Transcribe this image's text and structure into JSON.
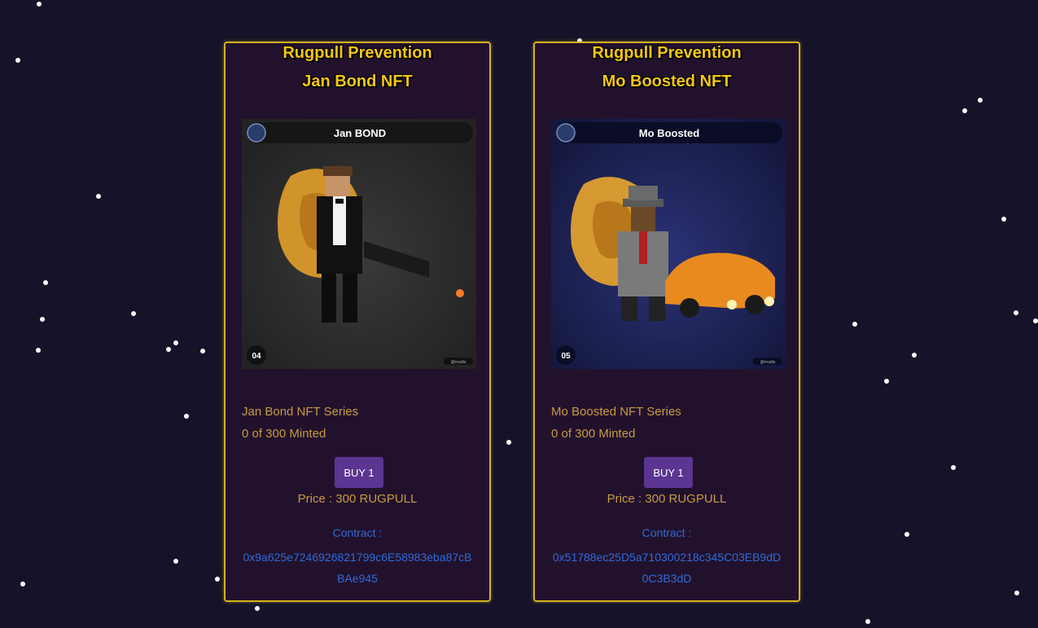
{
  "colors": {
    "page_background": "#16122a",
    "card_background": "#22112d",
    "card_border": "#d4b21c",
    "title": "#f5c518",
    "info_text": "#c89a3f",
    "button": "#5b3591",
    "contract_text": "#2f6bd8"
  },
  "cards": [
    {
      "title_line1": "Rugpull Prevention",
      "title_line2": "Jan Bond NFT",
      "image": {
        "banner_text": "Jan BOND",
        "number": "04",
        "watermark": "@rrvults",
        "background": "#2a2a2a"
      },
      "series": "Jan Bond NFT Series",
      "minted": "0 of 300 Minted",
      "buy_label": "BUY 1",
      "price": "Price : 300 RUGPULL",
      "contract_label": "Contract :",
      "contract_address": "0x9a625e7246926821799c6E58983eba87cBBAe945"
    },
    {
      "title_line1": "Rugpull Prevention",
      "title_line2": "Mo Boosted NFT",
      "image": {
        "banner_text": "Mo Boosted",
        "number": "05",
        "watermark": "@rrvults",
        "background": "#1b2050"
      },
      "series": "Mo Boosted NFT Series",
      "minted": "0 of 300 Minted",
      "buy_label": "BUY 1",
      "price": "Price : 300 RUGPULL",
      "contract_label": "Contract :",
      "contract_address": "0x51788ec25D5a710300218c345C03EB9dD0C3B3dD"
    }
  ]
}
